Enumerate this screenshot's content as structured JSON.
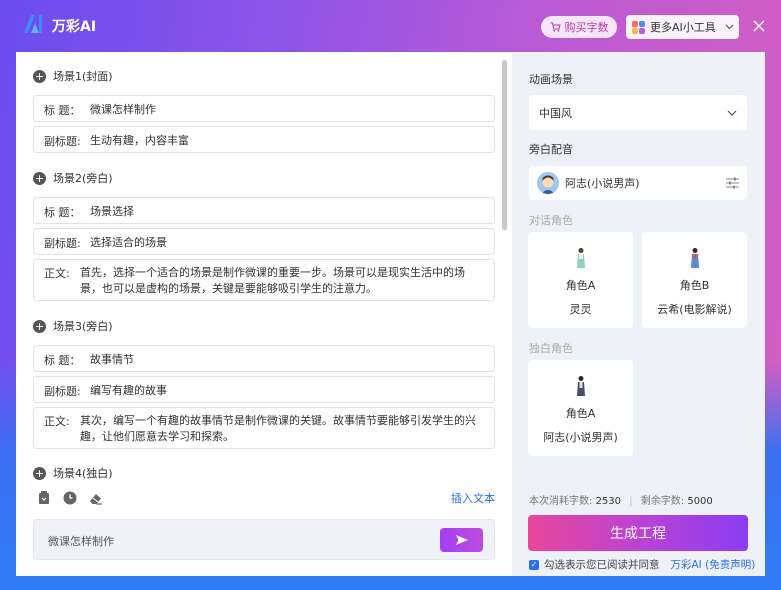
{
  "app": {
    "title": "万彩AI",
    "buy_label": "购买字数",
    "tools_label": "更多AI小工具"
  },
  "scenes": [
    {
      "head": "场景1(封面)",
      "fields": [
        {
          "label": "标 题：",
          "value": "微课怎样制作"
        },
        {
          "label": "副标题:",
          "value": "生动有趣，内容丰富"
        }
      ]
    },
    {
      "head": "场景2(旁白)",
      "fields": [
        {
          "label": "标 题：",
          "value": "场景选择"
        },
        {
          "label": "副标题:",
          "value": "选择适合的场景"
        },
        {
          "label": "正文:",
          "value": "首先，选择一个适合的场景是制作微课的重要一步。场景可以是现实生活中的场景，也可以是虚构的场景，关键是要能够吸引学生的注意力。"
        }
      ]
    },
    {
      "head": "场景3(旁白)",
      "fields": [
        {
          "label": "标 题：",
          "value": "故事情节"
        },
        {
          "label": "副标题:",
          "value": "编写有趣的故事"
        },
        {
          "label": "正文:",
          "value": "其次，编写一个有趣的故事情节是制作微课的关键。故事情节要能够引发学生的兴趣，让他们愿意去学习和探索。"
        }
      ]
    },
    {
      "head": "场景4(独白)",
      "fields": []
    }
  ],
  "editor": {
    "insert_label": "插入文本",
    "chat_value": "微课怎样制作"
  },
  "right": {
    "anim_scene_label": "动画场景",
    "anim_scene_value": "中国风",
    "voiceover_label": "旁白配音",
    "voiceover_value": "阿志(小说男声)",
    "dialog_label": "对话角色",
    "dialog_cards": [
      {
        "role": "角色A",
        "voice": "灵灵"
      },
      {
        "role": "角色B",
        "voice": "云希(电影解说)"
      }
    ],
    "mono_label": "独白角色",
    "mono_cards": [
      {
        "role": "角色A",
        "voice": "阿志(小说男声)"
      }
    ],
    "usage_label": "本次消耗字数:",
    "usage_value": "2530",
    "remain_label": "剩余字数:",
    "remain_value": "5000",
    "generate_label": "生成工程",
    "agree_text": "勾选表示您已阅读并同意",
    "agree_link": "万彩AI (免责声明)"
  },
  "colors": {
    "accent_blue": "#2a6ee8",
    "brand_purple": "#b742d8",
    "brand_pink": "#e9479a"
  }
}
